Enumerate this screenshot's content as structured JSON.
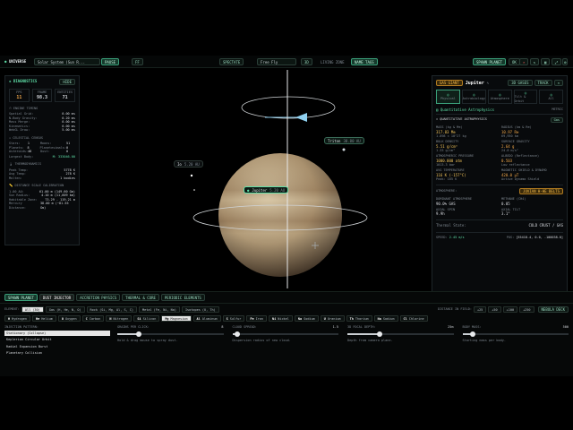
{
  "topbar": {
    "brand": "UNIVERSE",
    "system": "Solar System (Sun R...",
    "pause": "PAUSE",
    "ff": "FF",
    "spectate": "SPECTATE",
    "camera": "Free Fly",
    "hz": "3D",
    "living_zone": "LIVING ZONE",
    "name_tags": "NAME TAGS",
    "spawn": "SPAWN PLANET"
  },
  "diag": {
    "title": "DIAGNOSTICS",
    "mode": "HIDE",
    "fps_l": "FPS",
    "fps": "11",
    "frame_l": "FRAME",
    "frame": "98.3",
    "entities_l": "ENTITIES",
    "entities": "71",
    "engine_title": "ENGINE TIMING",
    "engine": [
      [
        "Spatial Grid:",
        "0.00 ms"
      ],
      [
        "N-Body Gravity:",
        "0.20 ms"
      ],
      [
        "Mass Merge:",
        "0.00 ms"
      ],
      [
        "Kinematics:",
        "0.00 ms"
      ],
      [
        "WebGL Draw:",
        "5.00 ms"
      ]
    ],
    "census_title": "CELESTIAL CENSUS",
    "census": [
      [
        "Stars:",
        "1",
        "Moons:",
        "51"
      ],
      [
        "Planets:",
        "8",
        "Planetesimals:",
        "0"
      ],
      [
        "Asteroids:",
        "48",
        "Dust:",
        "0"
      ]
    ],
    "largest": [
      "Largest Body:",
      "M: 333046.00"
    ],
    "thermo_title": "THERMODYNAMICS",
    "thermo": [
      [
        "Peak Temp:",
        "5778 K"
      ],
      [
        "Avg Temp:",
        "278 K"
      ],
      [
        "Molten:",
        "1 bodies"
      ]
    ],
    "scale_title": "DISTANCE SCALE CALIBRATION",
    "scale": [
      [
        "1.00 AU:",
        "61.00 m (149.60 Gm)"
      ],
      [
        "Sun Radius:",
        "4.10 m (11,609 km)"
      ],
      [
        "Habitable Zone:",
        "73.29 - 119.21 m"
      ],
      [
        "Mercury Distance:",
        "38.00 m (~81.55 Gm)"
      ]
    ]
  },
  "scene": {
    "triton": "Triton",
    "triton_v": "38.80 AU",
    "jupiter": "Jupiter",
    "jupiter_v": "5.20 AU",
    "io": "Io",
    "io_v": "5.20 AU"
  },
  "right": {
    "badge": "GAS GIANT",
    "name": "Jupiter",
    "gases": "3D GASES",
    "track": "TRACK",
    "tabs": [
      "Physical",
      "Astrobiology",
      "Atmosphere",
      "Tilt & Orbit",
      "All"
    ],
    "qa_title": "Quantitative Astrophysics",
    "qa_sub": "QUANTITATIVE ASTROPHYSICS",
    "qa_tag": "Gas",
    "qa_mode": "METRIC",
    "stats": [
      [
        "MASS (kg & M⊕)",
        "317.83 M⊕",
        "1.898 × 10^27 kg"
      ],
      [
        "RADIUS (km & R⊕)",
        "10.97 R⊕",
        "69,950 km"
      ],
      [
        "BULK DENSITY",
        "5.51 g/cm³",
        "1.33 g/cm³"
      ],
      [
        "SURFACE GRAVITY",
        "2.64 g",
        "24.8 m/s²"
      ],
      [
        "ATMOSPHERIC PRESSURE",
        "1000.000 atm",
        "1013.3 bar"
      ],
      [
        "ALBEDO (Reflectance)",
        "0.503",
        "Low reflectance"
      ],
      [
        "AVG TEMPERATURE",
        "116 K (-157°C)",
        "Peak: 165 K"
      ],
      [
        "MAGNETIC SHIELD & DYNAMO",
        "420.0 µT",
        "Active Dynamo Shield"
      ]
    ],
    "atm_label": "ATMOSPHERE:",
    "atm_val": "JOVIAN H-HE BELTS",
    "atm": [
      [
        "DOMINANT ATMOSPHERE",
        "90.0% GAS"
      ],
      [
        "METHANE (CH4)",
        "0.05"
      ],
      [
        "AXIAL SPIN",
        "9.9h"
      ],
      [
        "AXIAL TILT",
        "3.1°"
      ]
    ],
    "thermal_label": "Thermal State:",
    "thermal_val": "COLD CRUST / GAS",
    "speed_label": "SPEED:",
    "speed": "2.45 m/s",
    "pos_label": "POS:",
    "pos": "[55418.4, 0.0, -100038.0]"
  },
  "bottom": {
    "tabs": [
      "SPAWN PLANET",
      "DUST INJECTOR",
      "ACCRETION PHYSICS",
      "THERMAL & CORE",
      "PERIODIC ELEMENTS"
    ],
    "element_label": "ELEMENT:",
    "filters": [
      "All (30)",
      "Gas (H, He, N, O)",
      "Rock (Si, Mg, Al, S, C)",
      "Metal (Fe, Ni, Na)",
      "Isotopes (U, Th)"
    ],
    "dist_label": "DISTANCE IN FIELD:",
    "dist": [
      "+25",
      "+50",
      "+100",
      "+250"
    ],
    "nebula": "NEBULA DECK",
    "elements": [
      [
        "H",
        "Hydrogen"
      ],
      [
        "He",
        "Helium"
      ],
      [
        "O",
        "Oxygen"
      ],
      [
        "C",
        "Carbon"
      ],
      [
        "N",
        "Nitrogen"
      ],
      [
        "Si",
        "Silicon"
      ],
      [
        "Mg",
        "Magnesium"
      ],
      [
        "Al",
        "Aluminum"
      ],
      [
        "S",
        "Sulfur"
      ],
      [
        "Fe",
        "Iron"
      ],
      [
        "Ni",
        "Nickel"
      ],
      [
        "Na",
        "Sodium"
      ],
      [
        "U",
        "Uranium"
      ],
      [
        "Th",
        "Thorium"
      ],
      [
        "Na",
        "Sodium"
      ],
      [
        "Cl",
        "Chlorine"
      ]
    ],
    "pattern_label": "INJECTION PATTERN:",
    "patterns": [
      "Stationary (Collapse)",
      "Keplerian Circular Orbit",
      "Radial Expansion Burst",
      "Planetary Collision"
    ],
    "sliders": [
      [
        "GRAINS PER CLICK:",
        "8",
        "Hold & drag mouse to spray dust.",
        0.2
      ],
      [
        "CLOUD SPREAD:",
        "1.5",
        "Dispersion radius of new cloud.",
        0.05
      ],
      [
        "3D FOCAL DEPTH:",
        "25m",
        "Depth from camera plane.",
        0.3
      ],
      [
        "BODY MASS:",
        "500",
        "Starting mass per body.",
        0.1
      ]
    ]
  }
}
